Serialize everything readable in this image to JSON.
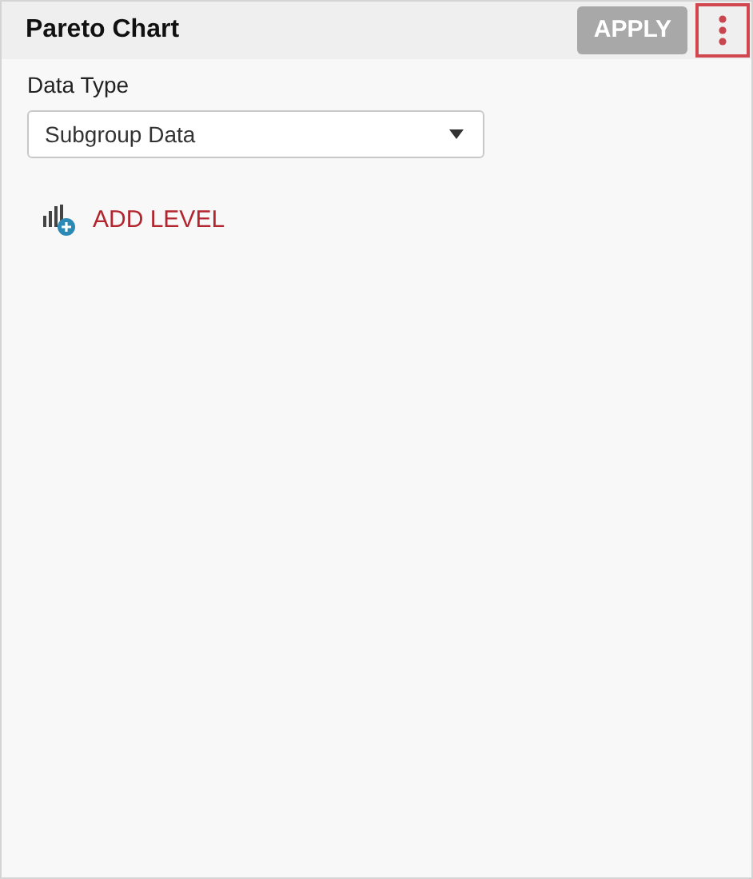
{
  "panel": {
    "title": "Pareto Chart"
  },
  "apply_button": {
    "label": "APPLY",
    "disabled": true
  },
  "menu_button": {
    "focused": true
  },
  "data_type": {
    "label": "Data Type",
    "value": "Subgroup Data"
  },
  "add_level": {
    "label": "ADD LEVEL"
  }
}
